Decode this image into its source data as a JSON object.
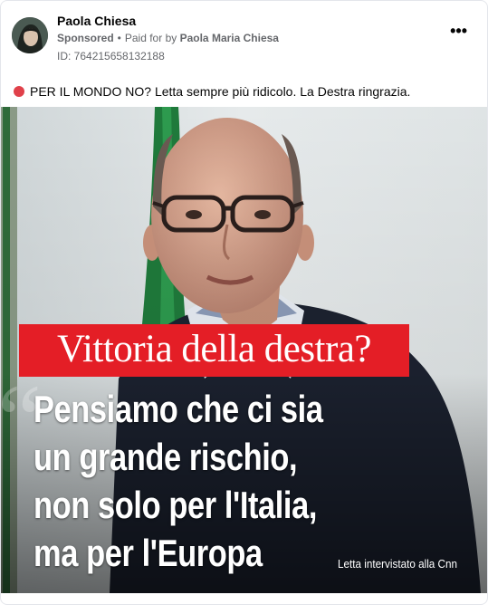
{
  "post": {
    "author": "Paola Chiesa",
    "sponsored": "Sponsored",
    "paid_for_label": "Paid for by",
    "paid_for_name": "Paola Maria Chiesa",
    "ad_id": "ID: 764215658132188",
    "more_label": "•••",
    "text": "PER IL MONDO NO? Letta sempre più ridicolo. La Destra ringrazia."
  },
  "media": {
    "banner": "Vittoria della destra?",
    "quote_lines": [
      "Pensiamo che ci sia",
      "un grande rischio,",
      "non solo per l'Italia,",
      "ma per l'Europa"
    ],
    "caption": "Letta intervistato alla Cnn"
  },
  "colors": {
    "banner_red": "#e41e26",
    "status_dot": "#e0414a"
  }
}
